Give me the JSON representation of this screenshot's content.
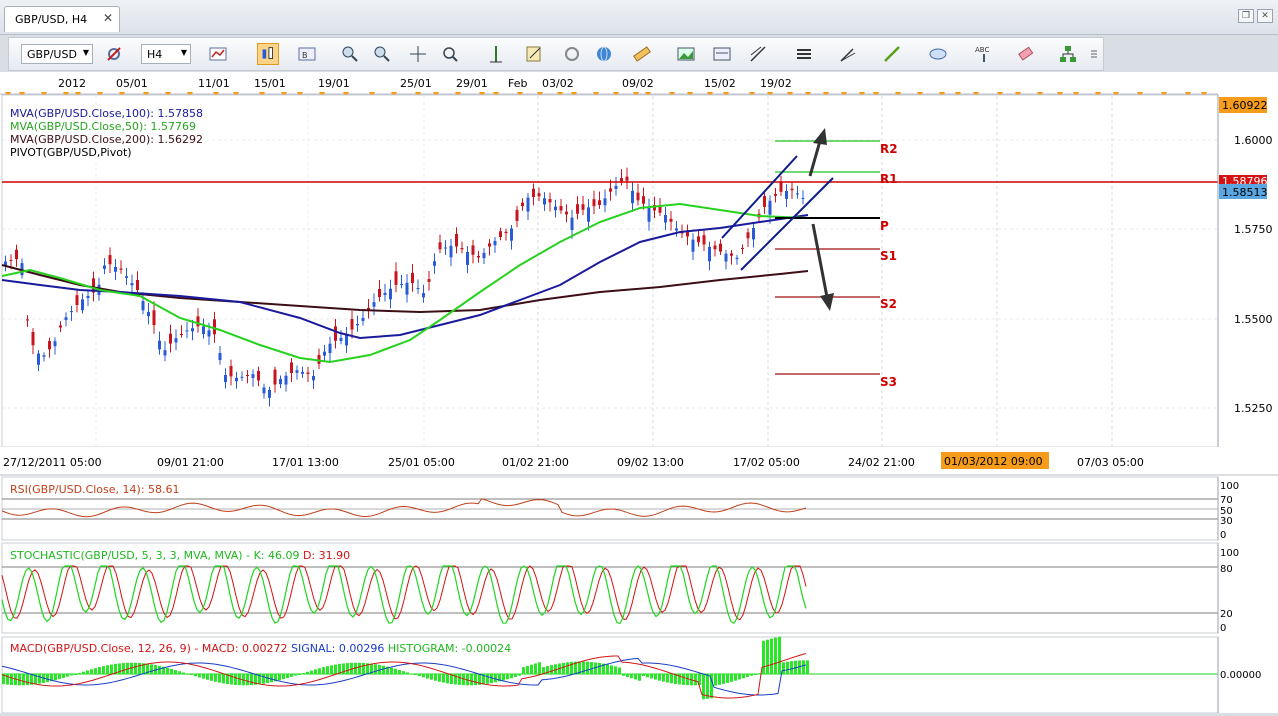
{
  "window": {
    "tab_title": "GBP/USD, H4",
    "close_glyph": "✕",
    "restore_glyph": "❐",
    "close_win_glyph": "✕"
  },
  "toolbar": {
    "symbol": "GBP/USD",
    "timeframe": "H4",
    "tools": [
      "chart-type",
      "bar-chart",
      "candle-chart",
      "line-chart",
      "zoom-in",
      "zoom-out",
      "crosshair",
      "zoom-tool",
      "period-separator",
      "save-template",
      "globe",
      "ruler",
      "image",
      "screenshot",
      "fibonacci",
      "channel",
      "pen",
      "line",
      "ellipse",
      "text",
      "eraser",
      "org-chart",
      "more"
    ]
  },
  "top_dates": [
    "2012",
    "05/01",
    "11/01",
    "15/01",
    "19/01",
    "25/01",
    "29/01",
    "Feb",
    "03/02",
    "09/02",
    "15/02",
    "19/02"
  ],
  "main_chart": {
    "indicators": [
      {
        "label": "MVA(GBP/USD.Close,100): 1.57858",
        "color": "#1a1a9c"
      },
      {
        "label": "MVA(GBP/USD.Close,50): 1.57769",
        "color": "#27c51f"
      },
      {
        "label": "MVA(GBP/USD.Close,200): 1.56292",
        "color": "#3c0e16"
      },
      {
        "label": "PIVOT(GBP/USD,Pivot)",
        "color": "#000000"
      }
    ],
    "price_ticks": [
      "1.6000",
      "1.5750",
      "1.5500",
      "1.5250"
    ],
    "last_high_label": "1.60922",
    "r1_price_label": "1.58796",
    "current_price_label": "1.58513",
    "pivot_labels": [
      "R2",
      "R1",
      "P",
      "S1",
      "S2",
      "S3"
    ],
    "x_labels": [
      "27/12/2011 05:00",
      "09/01 21:00",
      "17/01 13:00",
      "25/01 05:00",
      "01/02 21:00",
      "09/02 13:00",
      "17/02 05:00",
      "24/02 21:00",
      "07/03 05:00"
    ],
    "cursor_time_label": "01/03/2012 09:00"
  },
  "rsi": {
    "label": "RSI(GBP/USD.Close, 14): 58.61",
    "levels": [
      "100",
      "70",
      "50",
      "30",
      "0"
    ]
  },
  "stochastic": {
    "label_main": "STOCHASTIC(GBP/USD, 5, 3, 3, MVA, MVA) - ",
    "label_k": "K: 46.09",
    "label_d": "D: 31.90",
    "levels": [
      "100",
      "80",
      "20",
      "0"
    ]
  },
  "macd": {
    "label_main": "MACD(GBP/USD.Close, 12, 26, 9) - MACD: 0.00272",
    "label_signal": "SIGNAL: 0.00296",
    "label_hist": "HISTOGRAM: -0.00024",
    "levels": [
      "0.00000"
    ]
  },
  "colors": {
    "up_candle": "#2a5bd7",
    "down_candle": "#c8141e",
    "r1_line": "#d00000",
    "pivot_line": "#000000",
    "ma50": "#27c51f",
    "ma100": "#1a1a9c",
    "ma200": "#3c0e16",
    "rsi": "#c0401a",
    "stoch_k": "#1fd61f",
    "stoch_d": "#d41212",
    "macd": "#d01515",
    "signal": "#1a3cc8",
    "hist": "#29e629",
    "price_tag": "#f59c1a",
    "current_tag": "#5aa6e2"
  }
}
